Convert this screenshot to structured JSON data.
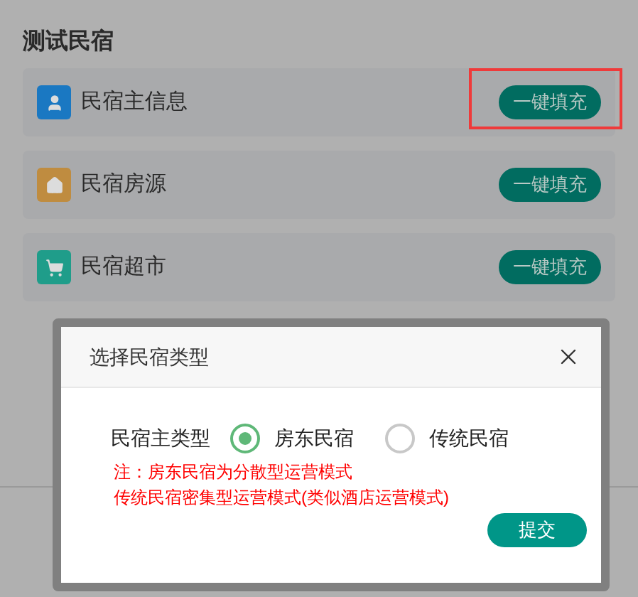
{
  "section": {
    "title": "测试民宿",
    "items": [
      {
        "label": "民宿主信息",
        "kind": "user",
        "color": "#1a78c2",
        "button": "一键填充",
        "highlighted": true
      },
      {
        "label": "民宿房源",
        "kind": "home",
        "color": "#bf8c40",
        "button": "一键填充",
        "highlighted": false
      },
      {
        "label": "民宿超市",
        "kind": "cart",
        "color": "#1f9d8a",
        "button": "一键填充",
        "highlighted": false
      }
    ]
  },
  "dialog": {
    "title": "选择民宿类型",
    "field_label": "民宿主类型",
    "options": [
      {
        "label": "房东民宿",
        "selected": true
      },
      {
        "label": "传统民宿",
        "selected": false
      }
    ],
    "note": [
      "注：房东民宿为分散型运营模式",
      "传统民宿密集型运营模式(类似酒店运营模式)"
    ],
    "submit": "提交"
  }
}
